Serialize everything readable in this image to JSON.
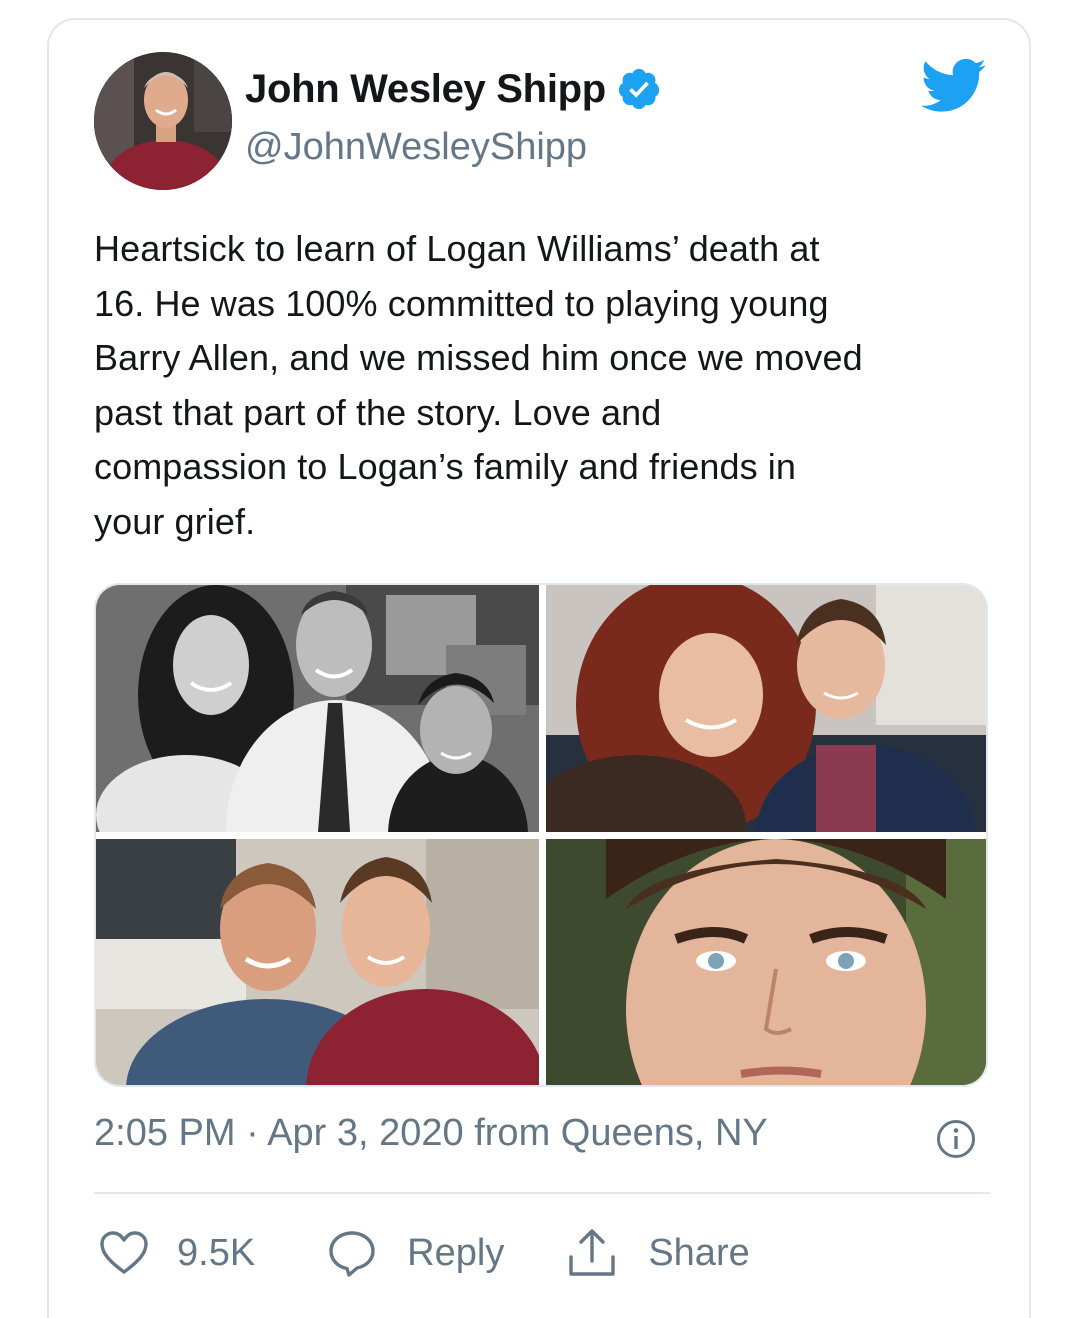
{
  "tweet": {
    "author_name": "John Wesley Shipp",
    "handle": "@JohnWesleyShipp",
    "text_lines": [
      "Heartsick to learn of Logan Williams’ death at",
      "16. He was 100% committed to playing young",
      "Barry Allen, and we missed him once we moved",
      "past that part of the story. Love and",
      "compassion to Logan’s family and friends in",
      "your grief."
    ],
    "meta": "2:05 PM · Apr 3, 2020 from Queens, NY",
    "likes": "9.5K",
    "reply_label": "Reply",
    "share_label": "Share"
  },
  "icons": {
    "verified": "verified-badge-icon",
    "brand": "twitter-bird-icon",
    "info": "info-icon",
    "like": "heart-icon",
    "reply": "speech-bubble-icon",
    "share": "share-upload-icon"
  },
  "colors": {
    "brand_blue": "#1da1f2",
    "text": "#14171a",
    "secondary": "#657786",
    "border": "#e1e8ed"
  }
}
